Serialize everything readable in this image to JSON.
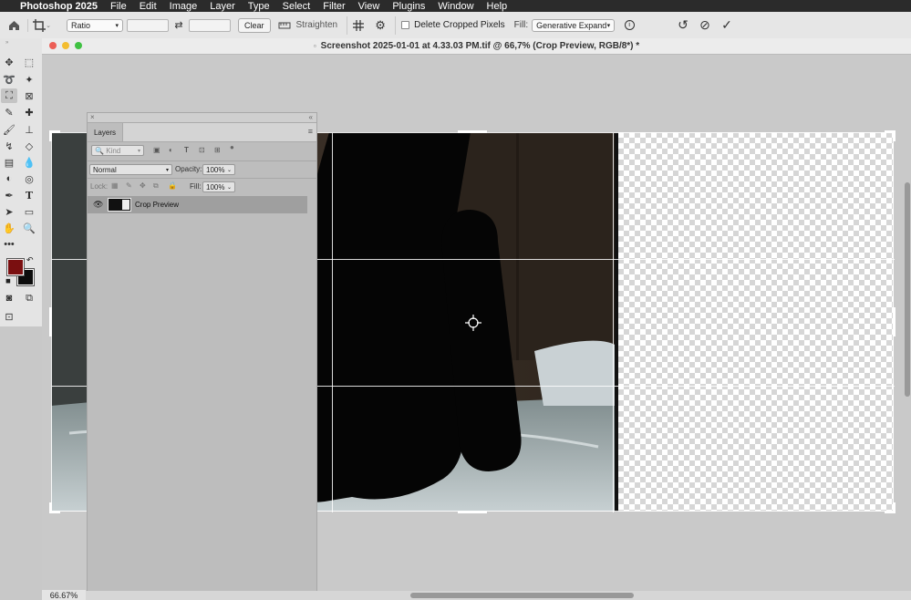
{
  "menubar": {
    "app_name": "Photoshop 2025",
    "items": [
      "File",
      "Edit",
      "Image",
      "Layer",
      "Type",
      "Select",
      "Filter",
      "View",
      "Plugins",
      "Window",
      "Help"
    ]
  },
  "options_bar": {
    "ratio_label": "Ratio",
    "width_value": "",
    "height_value": "",
    "clear_label": "Clear",
    "straighten_label": "Straighten",
    "delete_cropped_label": "Delete Cropped Pixels",
    "delete_cropped_checked": false,
    "fill_label": "Fill:",
    "fill_value": "Generative Expand"
  },
  "document": {
    "title": "Screenshot 2025-01-01 at 4.33.03 PM.tif @ 66,7% (Crop Preview, RGB/8*) *"
  },
  "colors": {
    "foreground": "#7a0f10",
    "background": "#0c0c0c"
  },
  "layers_panel": {
    "tab_label": "Layers",
    "kind_label": "Kind",
    "blend_mode": "Normal",
    "opacity_label": "Opacity:",
    "opacity_value": "100%",
    "lock_label": "Lock:",
    "fill_label": "Fill:",
    "fill_value": "100%",
    "layers": [
      {
        "name": "Crop Preview",
        "visible": true
      }
    ]
  },
  "status": {
    "zoom": "66.67%"
  },
  "icons": [
    "home-icon",
    "crop-icon",
    "swap-icon",
    "straighten-icon",
    "grid-overlay-icon",
    "settings-gear-icon",
    "info-icon",
    "reset-icon",
    "cancel-icon",
    "commit-check-icon",
    "eye-icon",
    "move-tool-icon",
    "marquee-tool-icon",
    "lasso-tool-icon",
    "magic-wand-icon",
    "crop-tool-icon",
    "frame-tool-icon",
    "eyedropper-icon",
    "healing-brush-icon",
    "brush-tool-icon",
    "stamp-tool-icon",
    "history-brush-icon",
    "eraser-icon",
    "gradient-icon",
    "blur-icon",
    "dodge-icon",
    "pen-tool-icon",
    "type-tool-icon",
    "path-select-icon",
    "rectangle-tool-icon",
    "hand-tool-icon",
    "zoom-tool-icon",
    "more-tools-icon",
    "quick-mask-icon",
    "screen-mode-icon",
    "crosshair-icon"
  ]
}
